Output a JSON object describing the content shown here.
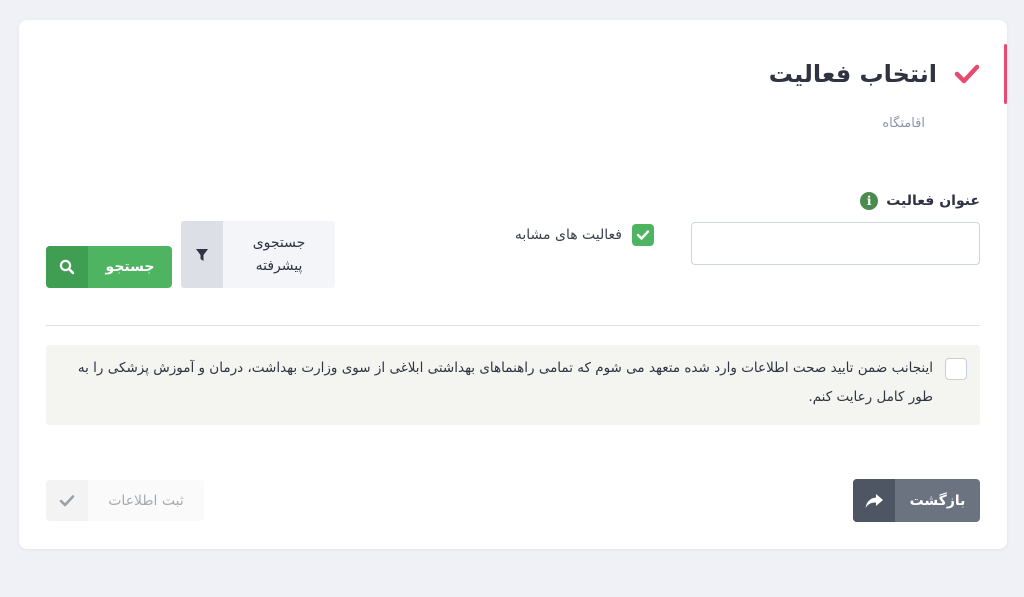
{
  "header": {
    "title": "انتخاب فعالیت",
    "subtitle": "اقامتگاه",
    "accent_color": "#e84a6f"
  },
  "form": {
    "field_label": "عنوان فعالیت",
    "field_value": "",
    "field_placeholder": "",
    "similar_activities_label": "فعالیت های مشابه",
    "similar_activities_checked": true,
    "advanced_search_label": "جستجوی پیشرفته",
    "search_button_label": "جستجو"
  },
  "agreement": {
    "checked": false,
    "text": "اینجانب ضمن تایید صحت اطلاعات وارد شده متعهد می شوم که تمامی راهنماهای بهداشتی ابلاغی از سوی وزارت بهداشت، درمان و آموزش پزشکی را به طور کامل رعایت کنم."
  },
  "footer": {
    "back_button_label": "بازگشت",
    "submit_button_label": "ثبت اطلاعات",
    "submit_disabled": true
  },
  "colors": {
    "green": "#4fb462",
    "gray_button": "#6b7280",
    "info_icon": "#4c8b4f"
  }
}
